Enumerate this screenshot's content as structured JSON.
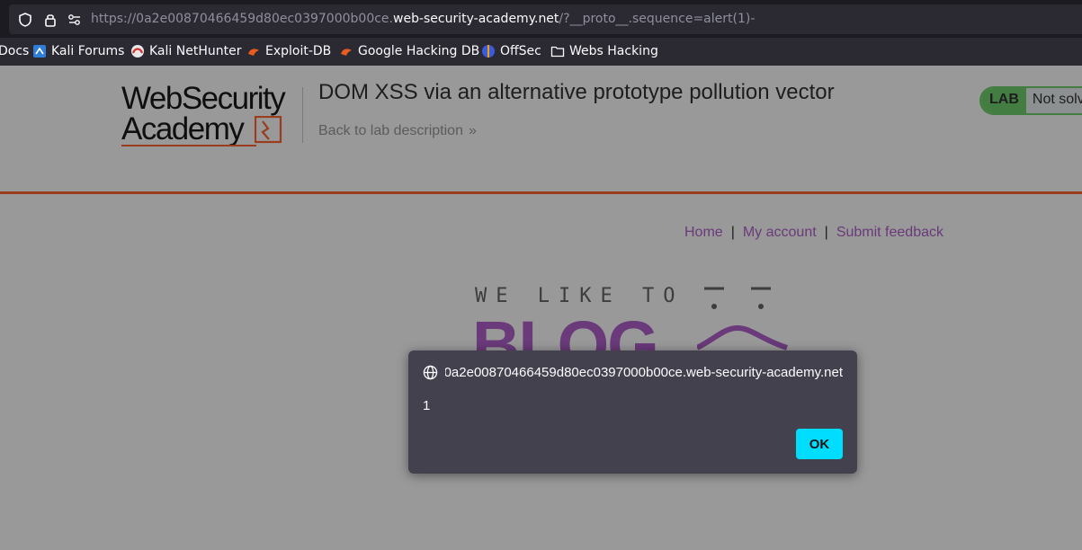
{
  "browser": {
    "url_prefix": "https://0a2e00870466459d80ec0397000b00ce.",
    "url_domain": "web-security-academy.net",
    "url_suffix": "/?__proto__.sequence=alert(1)-",
    "bookmarks": [
      {
        "label": "Docs",
        "icon": "docs-icon"
      },
      {
        "label": "Kali Forums",
        "icon": "kali-forums-icon"
      },
      {
        "label": "Kali NetHunter",
        "icon": "kali-nethunter-icon"
      },
      {
        "label": "Exploit-DB",
        "icon": "exploit-db-icon"
      },
      {
        "label": "Google Hacking DB",
        "icon": "google-hacking-db-icon"
      },
      {
        "label": "OffSec",
        "icon": "offsec-icon"
      },
      {
        "label": "Webs Hacking",
        "icon": "folder-icon"
      }
    ]
  },
  "header": {
    "logo_line1": "WebSecurity",
    "logo_line2": "Academy",
    "title": "DOM XSS via an alternative prototype pollution vector",
    "back_link": "Back to lab description",
    "badge": "LAB",
    "status": "Not solv"
  },
  "nav": {
    "home": "Home",
    "sep1": "|",
    "account": "My account",
    "sep2": "|",
    "feedback": "Submit feedback"
  },
  "blog": {
    "tagline": "WE LIKE TO",
    "word": "BLOG"
  },
  "dialog": {
    "origin": "0a2e00870466459d80ec0397000b00ce.web-security-academy.net",
    "message": "1",
    "ok_label": "OK"
  },
  "colors": {
    "accent_orange": "#ff6633",
    "link_purple": "#b162cc",
    "lab_green": "#70d16d",
    "ok_button": "#00ddff"
  }
}
